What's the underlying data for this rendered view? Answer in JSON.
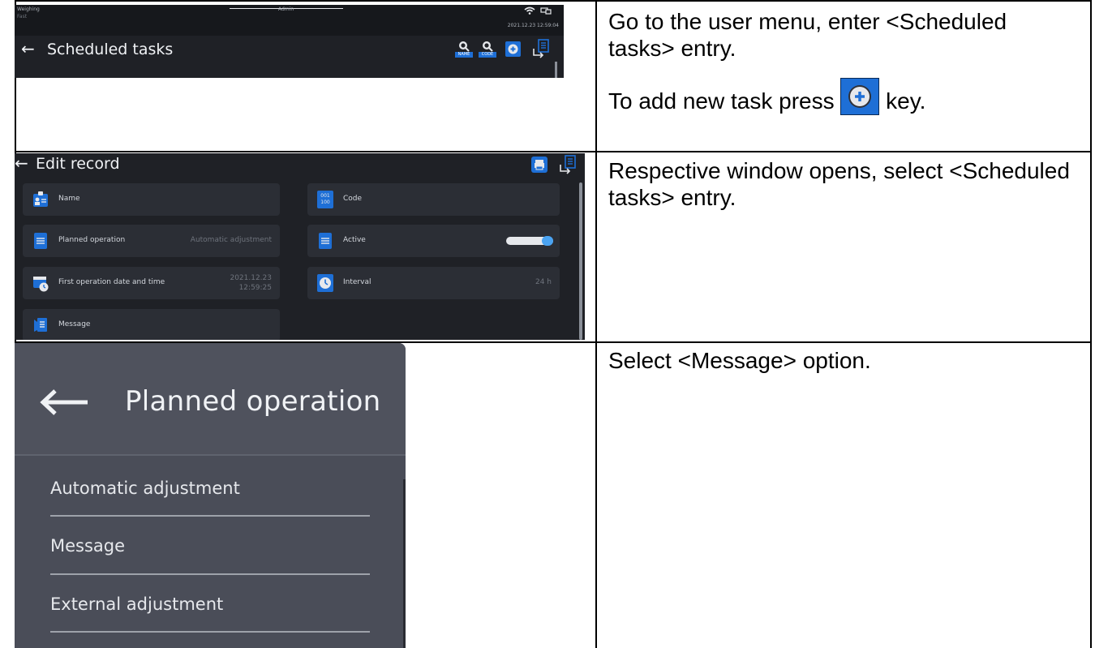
{
  "row1": {
    "screen": {
      "mode_top": "Weighing",
      "mode_sub": "Fast",
      "user": "Admin",
      "datetime": "2021.12.23 12:59:04",
      "title": "Scheduled tasks",
      "name_label": "NAME",
      "code_label": "CODE"
    },
    "instruction_line1": "Go to the user menu, enter <Scheduled tasks> entry.",
    "instruction_line2_before": "To add new task press",
    "instruction_line2_after": "key."
  },
  "row2": {
    "screen": {
      "title": "Edit record",
      "name_label": "Name",
      "code_label": "Code",
      "planned_label": "Planned operation",
      "planned_value": "Automatic adjustment",
      "active_label": "Active",
      "first_label": "First operation date and time",
      "first_date": "2021.12.23",
      "first_time": "12:59:25",
      "interval_label": "Interval",
      "interval_value": "24 h",
      "message_label": "Message",
      "code_icon_top": "001",
      "code_icon_bottom": "100",
      "active_on": true
    },
    "instruction": "Respective window opens, select <Scheduled tasks> entry."
  },
  "row3": {
    "screen": {
      "title": "Planned operation",
      "options": [
        "Automatic adjustment",
        "Message",
        "External adjustment"
      ]
    },
    "instruction": "Select <Message> option."
  },
  "colors": {
    "screen_dark": "#1f2126",
    "screen_gray": "#4a4d58",
    "accent_blue": "#1e6fd6"
  }
}
